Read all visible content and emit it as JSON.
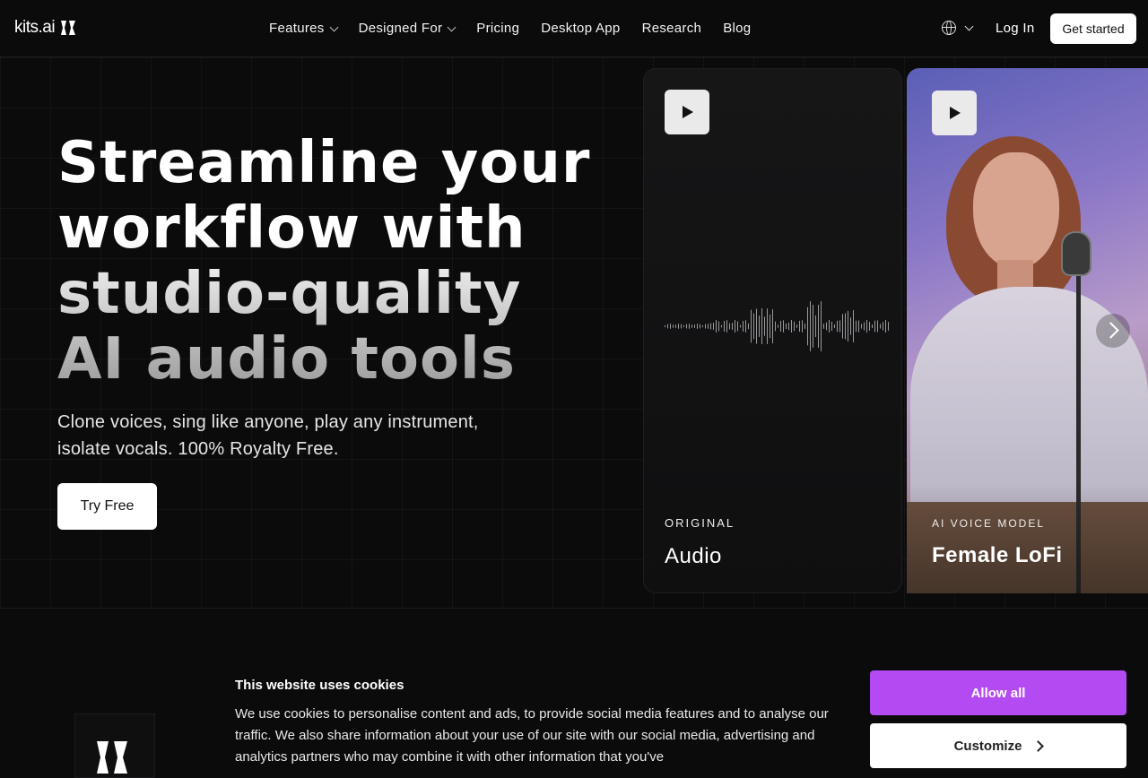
{
  "brand": {
    "name": "kits.ai"
  },
  "nav": {
    "items": [
      {
        "label": "Features",
        "dropdown": true
      },
      {
        "label": "Designed For",
        "dropdown": true
      },
      {
        "label": "Pricing",
        "dropdown": false
      },
      {
        "label": "Desktop App",
        "dropdown": false
      },
      {
        "label": "Research",
        "dropdown": false
      },
      {
        "label": "Blog",
        "dropdown": false
      }
    ],
    "login": "Log In",
    "cta": "Get started"
  },
  "hero": {
    "title": "Streamline your workflow with studio-quality AI audio tools",
    "subtitle": "Clone voices, sing like anyone, play any instrument, isolate vocals. 100% Royalty Free.",
    "cta": "Try Free"
  },
  "cards": [
    {
      "kicker": "ORIGINAL",
      "name": "Audio"
    },
    {
      "kicker": "AI VOICE MODEL",
      "name": "Female LoFi"
    }
  ],
  "cookie": {
    "title": "This website uses cookies",
    "text": "We use cookies to personalise content and ads, to provide social media features and to analyse our traffic. We also share information about your use of our site with our social media, advertising and analytics partners who may combine it with other information that you've",
    "allow": "Allow all",
    "customize": "Customize"
  },
  "colors": {
    "accent": "#b44bf2",
    "background": "#0b0b0c"
  }
}
